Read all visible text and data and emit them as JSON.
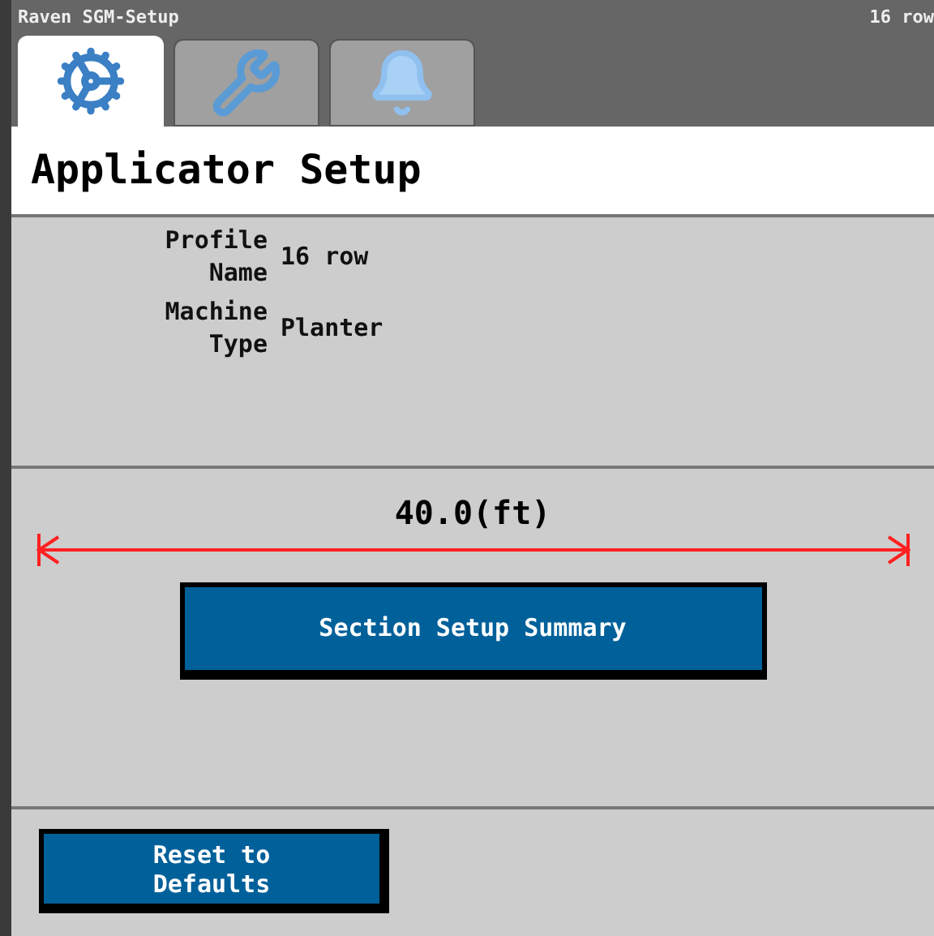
{
  "title_bar": {
    "title": "Raven SGM-Setup",
    "profile": "16 row"
  },
  "tabs": [
    {
      "selected": true
    },
    {
      "selected": false
    },
    {
      "selected": false
    }
  ],
  "page_title": "Applicator Setup",
  "fields": [
    {
      "label": "Profile Name",
      "value": "16 row"
    },
    {
      "label": "Machine Type",
      "value": "Planter"
    }
  ],
  "width_reading": "40.0(ft)",
  "section_button": "Section Setup Summary",
  "reset_button": "Reset to Defaults"
}
